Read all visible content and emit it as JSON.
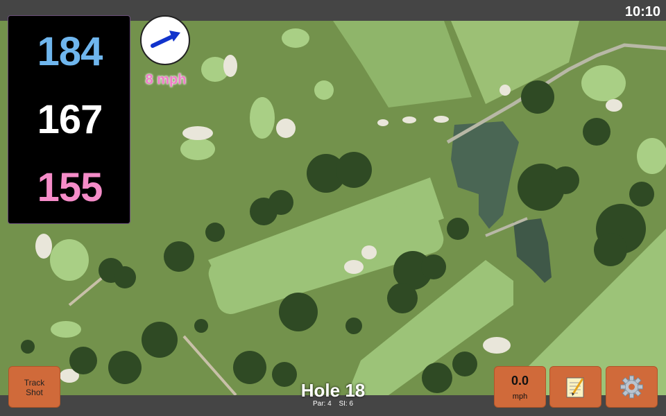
{
  "status": {
    "time": "10:10"
  },
  "distances": {
    "back": "184",
    "middle": "167",
    "front": "155"
  },
  "wind": {
    "label": "8 mph",
    "icon": "arrow-icon"
  },
  "buttons": {
    "track_shot_line1": "Track",
    "track_shot_line2": "Shot",
    "speed_value": "0.0",
    "speed_unit": "mph",
    "notes_icon": "notepad-icon",
    "settings_icon": "gear-icon"
  },
  "hole": {
    "title": "Hole 18",
    "par": "Par: 4",
    "si": "SI: 6"
  },
  "colors": {
    "back": "#6fb6ee",
    "middle": "#ffffff",
    "front": "#f58cc8",
    "button": "#d06a3a",
    "wind_text": "#f07cc8"
  }
}
